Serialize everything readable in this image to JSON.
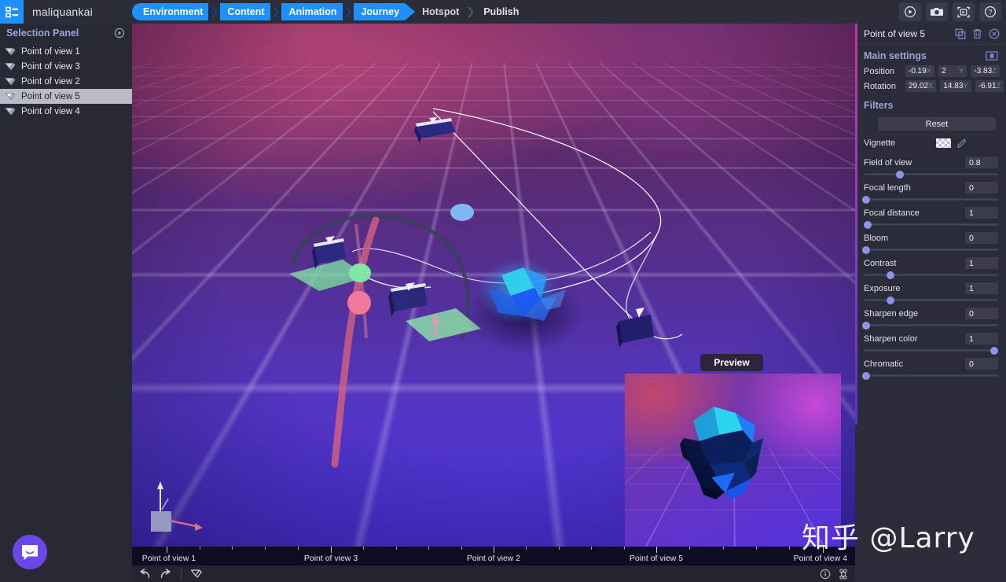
{
  "app": {
    "logo_icon": "list-grid-icon",
    "brand": "maliquankai",
    "watermark": "知乎 @Larry"
  },
  "breadcrumbs": {
    "items": [
      {
        "label": "Environment",
        "state": "done"
      },
      {
        "label": "Content",
        "state": "done"
      },
      {
        "label": "Animation",
        "state": "done"
      },
      {
        "label": "Journey",
        "state": "active"
      },
      {
        "label": "Hotspot",
        "state": "pending"
      },
      {
        "label": "Publish",
        "state": "pending"
      }
    ],
    "accent_color": "#1e90ff"
  },
  "top_tools": [
    {
      "name": "play-button",
      "icon": "play-circle-icon"
    },
    {
      "name": "screenshot-button",
      "icon": "camera-icon"
    },
    {
      "name": "record-video-button",
      "icon": "video-frame-icon"
    },
    {
      "name": "help-button",
      "icon": "question-circle-icon"
    }
  ],
  "selection_panel": {
    "title": "Selection Panel",
    "collapse_icon": "collapse-circle-icon",
    "items": [
      {
        "label": "Point of view 1",
        "icon": "viewpoint-gizmo-icon",
        "selected": false
      },
      {
        "label": "Point of view 3",
        "icon": "viewpoint-gizmo-icon",
        "selected": false
      },
      {
        "label": "Point of view 2",
        "icon": "viewpoint-gizmo-icon",
        "selected": false
      },
      {
        "label": "Point of view 5",
        "icon": "viewpoint-gizmo-icon",
        "selected": true
      },
      {
        "label": "Point of view 4",
        "icon": "viewpoint-gizmo-icon",
        "selected": false
      }
    ]
  },
  "viewport": {
    "preview_label": "Preview",
    "axis_gizmo_icon": "axis-gizmo-icon"
  },
  "timeline": {
    "keyframes": [
      {
        "label": "Point of view 1",
        "pos_pct": 4.8
      },
      {
        "label": "Point of view 3",
        "pos_pct": 27.5
      },
      {
        "label": "Point of view 2",
        "pos_pct": 50.0
      },
      {
        "label": "Point of view 5",
        "pos_pct": 72.5
      },
      {
        "label": "Point of view 4",
        "pos_pct": 95.5
      }
    ],
    "tools": [
      {
        "name": "undo-button",
        "icon": "undo-icon"
      },
      {
        "name": "redo-button",
        "icon": "redo-icon"
      },
      {
        "name": "add-viewpoint-button",
        "icon": "viewpoint-gizmo-icon"
      }
    ],
    "right_tools": [
      {
        "name": "info-button",
        "icon": "info-circle-icon"
      },
      {
        "name": "shortcuts-button",
        "icon": "command-key-icon"
      }
    ]
  },
  "inspector": {
    "title": "Point of view 5",
    "header_icons": [
      {
        "name": "duplicate-button",
        "icon": "duplicate-icon"
      },
      {
        "name": "delete-button",
        "icon": "trash-icon"
      },
      {
        "name": "close-button",
        "icon": "close-circle-icon"
      }
    ],
    "main_settings": {
      "title": "Main settings",
      "expand_icon": "panel-expand-icon",
      "rows": [
        {
          "label": "Position",
          "fields": [
            {
              "value": "-0.19",
              "axis": "X"
            },
            {
              "value": "2",
              "axis": "Y"
            },
            {
              "value": "-3.83",
              "axis": "Z"
            }
          ]
        },
        {
          "label": "Rotation",
          "fields": [
            {
              "value": "29.02",
              "axis": "X"
            },
            {
              "value": "14.83",
              "axis": "Y"
            },
            {
              "value": "-6.91",
              "axis": "Z"
            }
          ]
        }
      ]
    },
    "filters": {
      "title": "Filters",
      "reset_label": "Reset",
      "vignette": {
        "label": "Vignette",
        "swatch": "checkerboard-transparent",
        "edit_icon": "pencil-icon"
      },
      "sliders": [
        {
          "label": "Field of view",
          "value": "0.8",
          "pos_pct": 27
        },
        {
          "label": "Focal length",
          "value": "0",
          "pos_pct": 2
        },
        {
          "label": "Focal distance",
          "value": "1",
          "pos_pct": 3
        },
        {
          "label": "Bloom",
          "value": "0",
          "pos_pct": 2
        },
        {
          "label": "Contrast",
          "value": "1",
          "pos_pct": 20
        },
        {
          "label": "Exposure",
          "value": "1",
          "pos_pct": 20
        },
        {
          "label": "Sharpen edge",
          "value": "0",
          "pos_pct": 2
        },
        {
          "label": "Sharpen color",
          "value": "1",
          "pos_pct": 97
        },
        {
          "label": "Chromatic",
          "value": "0",
          "pos_pct": 2
        }
      ]
    }
  },
  "support": {
    "icon": "intercom-chat-icon",
    "color": "#6c47e8"
  }
}
